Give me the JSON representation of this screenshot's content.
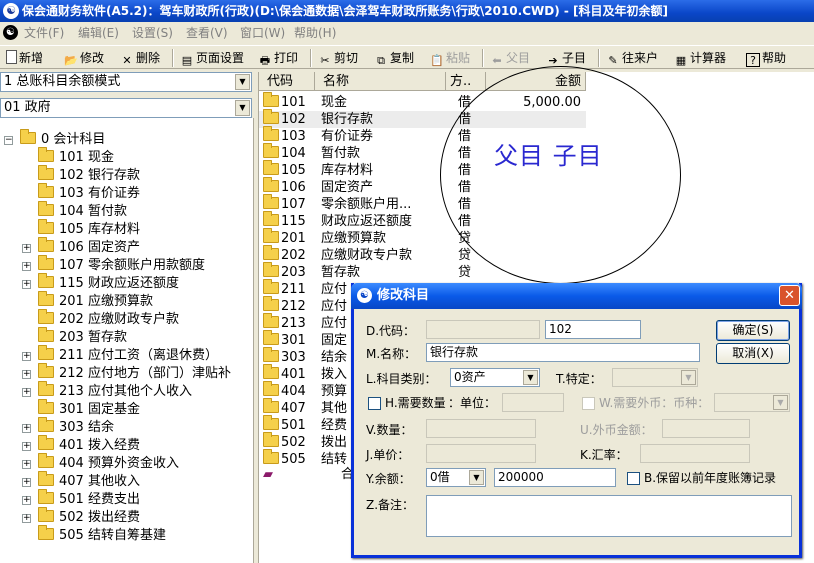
{
  "window": {
    "title": "保会通财务软件(A5.2)：驾车财政所(行政)(D:\\保会通数据\\会泽驾车财政所账务\\行政\\2010.CWD) - [科目及年初余额]"
  },
  "menu": [
    "文件(F)",
    "编辑(E)",
    "设置(S)",
    "查看(V)",
    "窗口(W)",
    "帮助(H)"
  ],
  "toolbar": {
    "new": "新增",
    "edit": "修改",
    "delete": "删除",
    "page_setup": "页面设置",
    "print": "打印",
    "cut": "剪切",
    "copy": "复制",
    "paste": "粘贴",
    "parent": "父目",
    "child": "子目",
    "account": "往来户",
    "calculator": "计算器",
    "help": "帮助"
  },
  "left": {
    "mode_select": "1 总账科目余额模式",
    "category_select": "01 政府",
    "root": "0 会计科目",
    "items": [
      {
        "label": "101 现金",
        "expandable": false
      },
      {
        "label": "102 银行存款",
        "expandable": false
      },
      {
        "label": "103 有价证券",
        "expandable": false
      },
      {
        "label": "104 暂付款",
        "expandable": false
      },
      {
        "label": "105 库存材料",
        "expandable": false
      },
      {
        "label": "106 固定资产",
        "expandable": true
      },
      {
        "label": "107 零余额账户用款额度",
        "expandable": true
      },
      {
        "label": "115 财政应返还额度",
        "expandable": true
      },
      {
        "label": "201 应缴预算款",
        "expandable": false
      },
      {
        "label": "202 应缴财政专户款",
        "expandable": false
      },
      {
        "label": "203 暂存款",
        "expandable": false
      },
      {
        "label": "211 应付工资（离退休费）",
        "expandable": true
      },
      {
        "label": "212 应付地方（部门）津贴补",
        "expandable": true
      },
      {
        "label": "213 应付其他个人收入",
        "expandable": true
      },
      {
        "label": "301 固定基金",
        "expandable": false
      },
      {
        "label": "303 结余",
        "expandable": true
      },
      {
        "label": "401 拨入经费",
        "expandable": true
      },
      {
        "label": "404 预算外资金收入",
        "expandable": true
      },
      {
        "label": "407 其他收入",
        "expandable": true
      },
      {
        "label": "501 经费支出",
        "expandable": true
      },
      {
        "label": "502 拨出经费",
        "expandable": true
      },
      {
        "label": "505 结转自筹基建",
        "expandable": false
      }
    ]
  },
  "grid": {
    "headers": [
      "代码",
      "名称",
      "方..",
      "金额"
    ],
    "rows": [
      {
        "code": "101",
        "name": "现金",
        "dir": "借",
        "amount": "5,000.00"
      },
      {
        "code": "102",
        "name": "银行存款",
        "dir": "借",
        "amount": ""
      },
      {
        "code": "103",
        "name": "有价证券",
        "dir": "借",
        "amount": ""
      },
      {
        "code": "104",
        "name": "暂付款",
        "dir": "借",
        "amount": ""
      },
      {
        "code": "105",
        "name": "库存材料",
        "dir": "借",
        "amount": ""
      },
      {
        "code": "106",
        "name": "固定资产",
        "dir": "借",
        "amount": ""
      },
      {
        "code": "107",
        "name": "零余额账户用...",
        "dir": "借",
        "amount": ""
      },
      {
        "code": "115",
        "name": "财政应返还额度",
        "dir": "借",
        "amount": ""
      },
      {
        "code": "201",
        "name": "应缴预算款",
        "dir": "贷",
        "amount": ""
      },
      {
        "code": "202",
        "name": "应缴财政专户款",
        "dir": "贷",
        "amount": ""
      },
      {
        "code": "203",
        "name": "暂存款",
        "dir": "贷",
        "amount": ""
      },
      {
        "code": "211",
        "name": "应付",
        "dir": "",
        "amount": ""
      },
      {
        "code": "212",
        "name": "应付",
        "dir": "",
        "amount": ""
      },
      {
        "code": "213",
        "name": "应付",
        "dir": "",
        "amount": ""
      },
      {
        "code": "301",
        "name": "固定",
        "dir": "",
        "amount": ""
      },
      {
        "code": "303",
        "name": "结余",
        "dir": "",
        "amount": ""
      },
      {
        "code": "401",
        "name": "拨入",
        "dir": "",
        "amount": ""
      },
      {
        "code": "404",
        "name": "预算",
        "dir": "",
        "amount": ""
      },
      {
        "code": "407",
        "name": "其他",
        "dir": "",
        "amount": ""
      },
      {
        "code": "501",
        "name": "经费",
        "dir": "",
        "amount": ""
      },
      {
        "code": "502",
        "name": "拨出",
        "dir": "",
        "amount": ""
      },
      {
        "code": "505",
        "name": "结转",
        "dir": "",
        "amount": ""
      }
    ],
    "total_label": "合"
  },
  "annotation": "父目  子目",
  "dialog": {
    "title": "修改科目",
    "code_label": "D.代码：",
    "code_value": "102",
    "name_label": "M.名称：",
    "name_value": "银行存款",
    "type_label": "L.科目类别：",
    "type_value": "0资产",
    "special_label": "T.特定：",
    "qty_check_label": "H.需要数量",
    "unit_label": "：单位：",
    "foreign_check_label": "W.需要外币：币种：",
    "qty_label": "V.数量：",
    "foreign_amount_label": "U.外币金额：",
    "price_label": "J.单价：",
    "rate_label": "K.汇率：",
    "balance_label": "Y.余额：",
    "balance_dir": "0借",
    "balance_value": "200000",
    "keep_label": "B.保留以前年度账簿记录",
    "note_label": "Z.备注：",
    "ok": "确定(S)",
    "cancel": "取消(X)"
  }
}
